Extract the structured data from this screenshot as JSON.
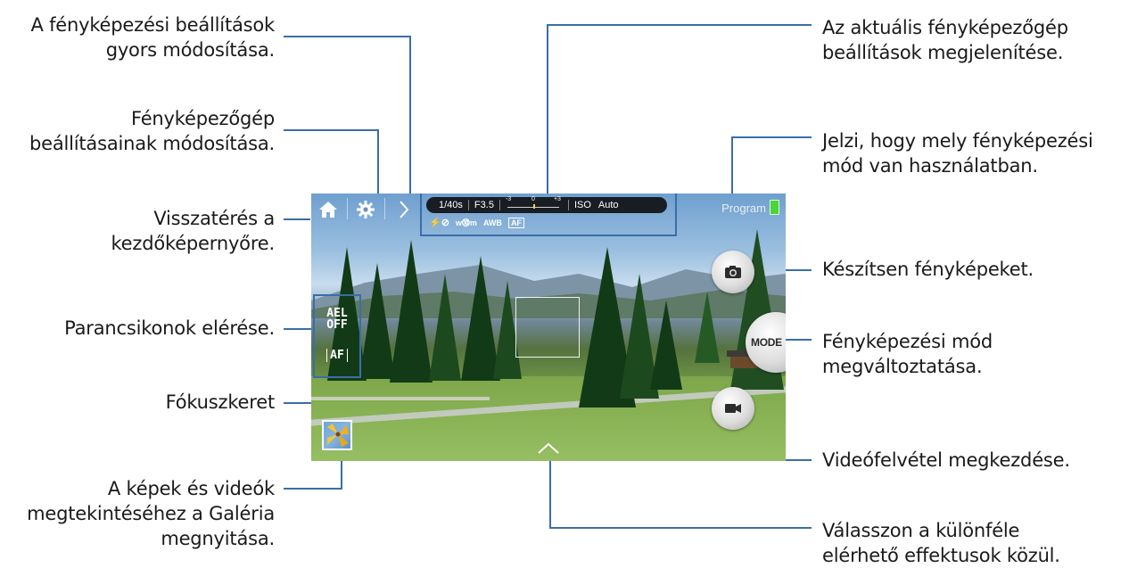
{
  "annotations": {
    "quick_settings": [
      "A fényképezési beállítások",
      "gyors módosítása."
    ],
    "camera_settings": [
      "Fényképezőgép",
      "beállításainak módosítása."
    ],
    "home_return": [
      "Visszatérés a",
      "kezdőképernyőre."
    ],
    "shortcuts": [
      "Parancsikonok elérése."
    ],
    "focus_frame": [
      "Fókuszkeret"
    ],
    "gallery": [
      "A képek és videók",
      "megtekintéséhez a Galéria",
      "megnyitása."
    ],
    "current_settings": [
      "Az aktuális fényképezőgép",
      "beállítások megjelenítése."
    ],
    "shooting_mode_indicator": [
      "Jelzi, hogy mely fényképezési",
      "mód van használatban."
    ],
    "take_photo": [
      "Készítsen fényképeket."
    ],
    "change_mode": [
      "Fényképezési mód",
      "megváltoztatása."
    ],
    "start_video": [
      "Videófelvétel megkezdése."
    ],
    "effects": [
      "Válasszon a különféle",
      "elérhető effektusok közül."
    ]
  },
  "camera": {
    "shutter_speed": "1/40s",
    "aperture": "F3.5",
    "exposure_scale": {
      "min": "-3",
      "mid": "0",
      "max": "+3"
    },
    "iso_label": "ISO",
    "iso_value": "Auto",
    "flash_icon": "flash-off-icon",
    "wb_label": "AWB",
    "af_label": "AF",
    "mode_name": "Program",
    "shortcut_ael_top": "AEL",
    "shortcut_ael_bottom": "OFF",
    "shortcut_af": "AF",
    "mode_button": "MODE"
  },
  "icons": [
    "home-icon",
    "gear-icon",
    "chevron-right-icon",
    "camera-icon",
    "video-camera-icon",
    "chevron-up-icon",
    "battery-icon",
    "gallery-thumbnail"
  ],
  "colors": {
    "leader": "#3a6ea8",
    "battery": "#4cd43b",
    "text": "#1a1a1a"
  }
}
